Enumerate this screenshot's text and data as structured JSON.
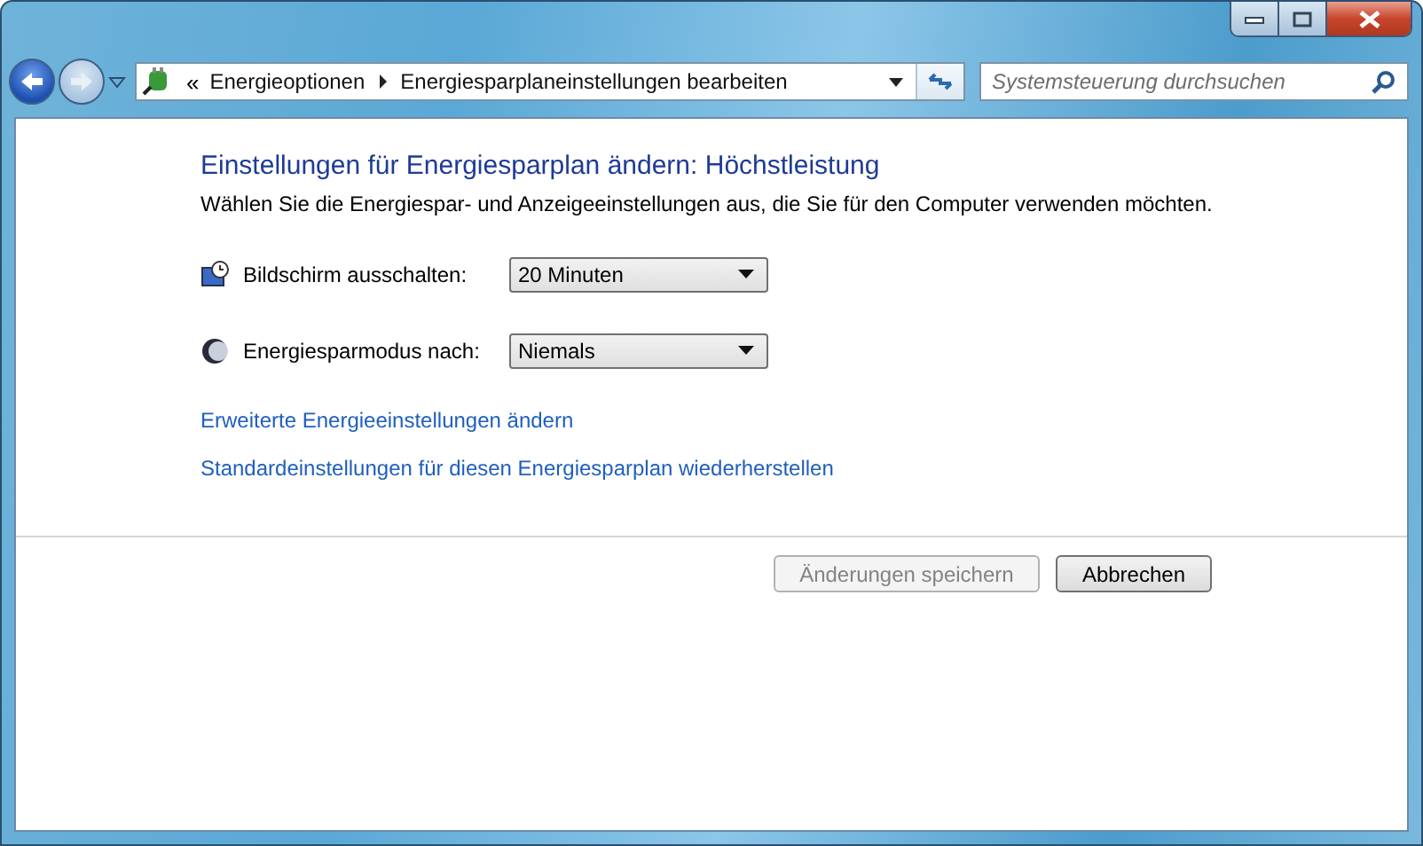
{
  "breadcrumb": {
    "overflow": "«",
    "items": [
      "Energieoptionen",
      "Energiesparplaneinstellungen bearbeiten"
    ]
  },
  "search": {
    "placeholder": "Systemsteuerung durchsuchen"
  },
  "heading": "Einstellungen für Energiesparplan ändern: Höchstleistung",
  "description": "Wählen Sie die Energiespar- und Anzeigeeinstellungen aus, die Sie für den Computer verwenden möchten.",
  "settings": [
    {
      "kind": "display",
      "label": "Bildschirm ausschalten:",
      "value": "20 Minuten"
    },
    {
      "kind": "sleep",
      "label": "Energiesparmodus nach:",
      "value": "Niemals"
    }
  ],
  "links": [
    "Erweiterte Energieeinstellungen ändern",
    "Standardeinstellungen für diesen Energiesparplan wiederherstellen"
  ],
  "buttons": [
    {
      "label": "Änderungen speichern",
      "disabled": true
    },
    {
      "label": "Abbrechen",
      "disabled": false
    }
  ]
}
